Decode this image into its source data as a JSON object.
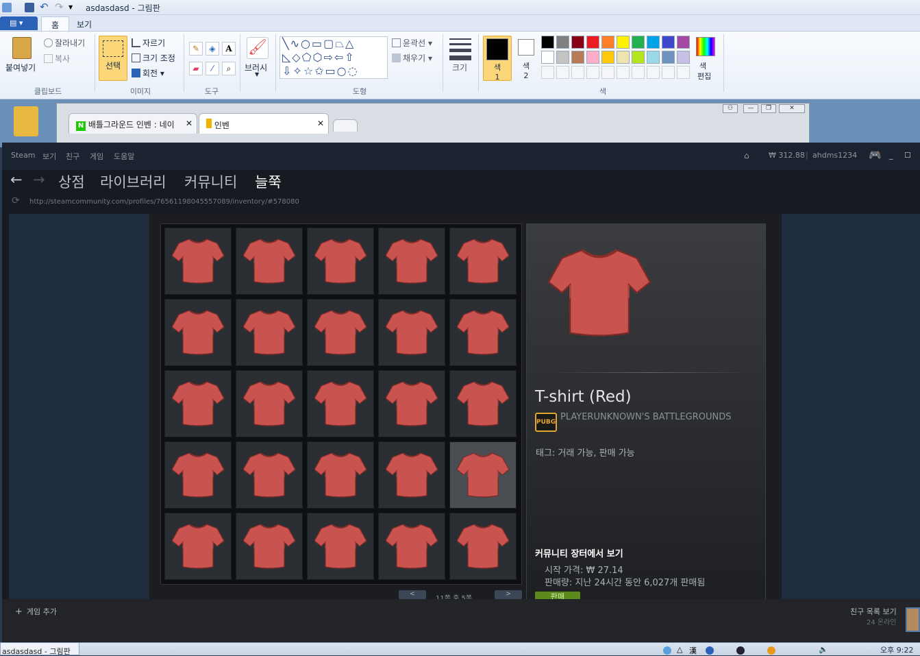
{
  "paint": {
    "title": "asdasdasd - 그림판",
    "tabs": [
      "홈",
      "보기"
    ],
    "clipboard": {
      "paste": "붙여넣기",
      "cut": "잘라내기",
      "copy": "복사",
      "group": "클립보드"
    },
    "image": {
      "select": "선택",
      "crop": "자르기",
      "resize": "크기 조정",
      "rotate": "회전",
      "group": "이미지"
    },
    "tools_group": "도구",
    "brush": "브러시",
    "shapes": {
      "outline": "윤곽선",
      "fill": "채우기",
      "group": "도형"
    },
    "size": "크기",
    "color1": {
      "label": "색",
      "num": "1"
    },
    "color2": {
      "label": "색",
      "num": "2"
    },
    "edit_colors": {
      "l1": "색",
      "l2": "편집"
    },
    "colors_group": "색",
    "palette_row1": [
      "#000000",
      "#7f7f7f",
      "#880015",
      "#ed1c24",
      "#ff7f27",
      "#fff200",
      "#22b14c",
      "#00a2e8",
      "#3f48cc",
      "#a349a4"
    ],
    "palette_row2": [
      "#ffffff",
      "#c3c3c3",
      "#b97a57",
      "#ffaec9",
      "#ffc90e",
      "#efe4b0",
      "#b5e61d",
      "#99d9ea",
      "#7092be",
      "#c8bfe7"
    ]
  },
  "browser": {
    "tab1": "배틀그라운드 인벤 : 네이",
    "tab2": "인벤",
    "tab1_icon": "N"
  },
  "steam": {
    "menu": [
      "Steam",
      "보기",
      "친구",
      "게임",
      "도움말"
    ],
    "wallet": "₩ 312.88",
    "username": "ahdms1234",
    "nav": [
      "상점",
      "라이브러리",
      "커뮤니티",
      "늘쭉"
    ],
    "url": "http://steamcommunity.com/profiles/76561198045557089/inventory/#578080",
    "item_name": "T-shirt (Red)",
    "game_badge": "PUBG",
    "game_name": "PLAYERUNKNOWN'S BATTLEGROUNDS",
    "tags": "태그: 거래 가능, 판매 가능",
    "market_title": "커뮤니티 장터에서 보기",
    "start_price": "시작 가격: ₩ 27.14",
    "volume": "판매량: 지난 24시간 동안 6,027개 판매됨",
    "sell": "판매",
    "pager_prev": "<",
    "pager_text": "11쪽 중 5쪽",
    "pager_next": ">",
    "add_game": "게임 추가",
    "friends_list": "친구 목록 보기",
    "online": "24 온라인"
  },
  "taskbar": {
    "item": "asdasdasd - 그림판",
    "clock": "오후 9:22"
  }
}
